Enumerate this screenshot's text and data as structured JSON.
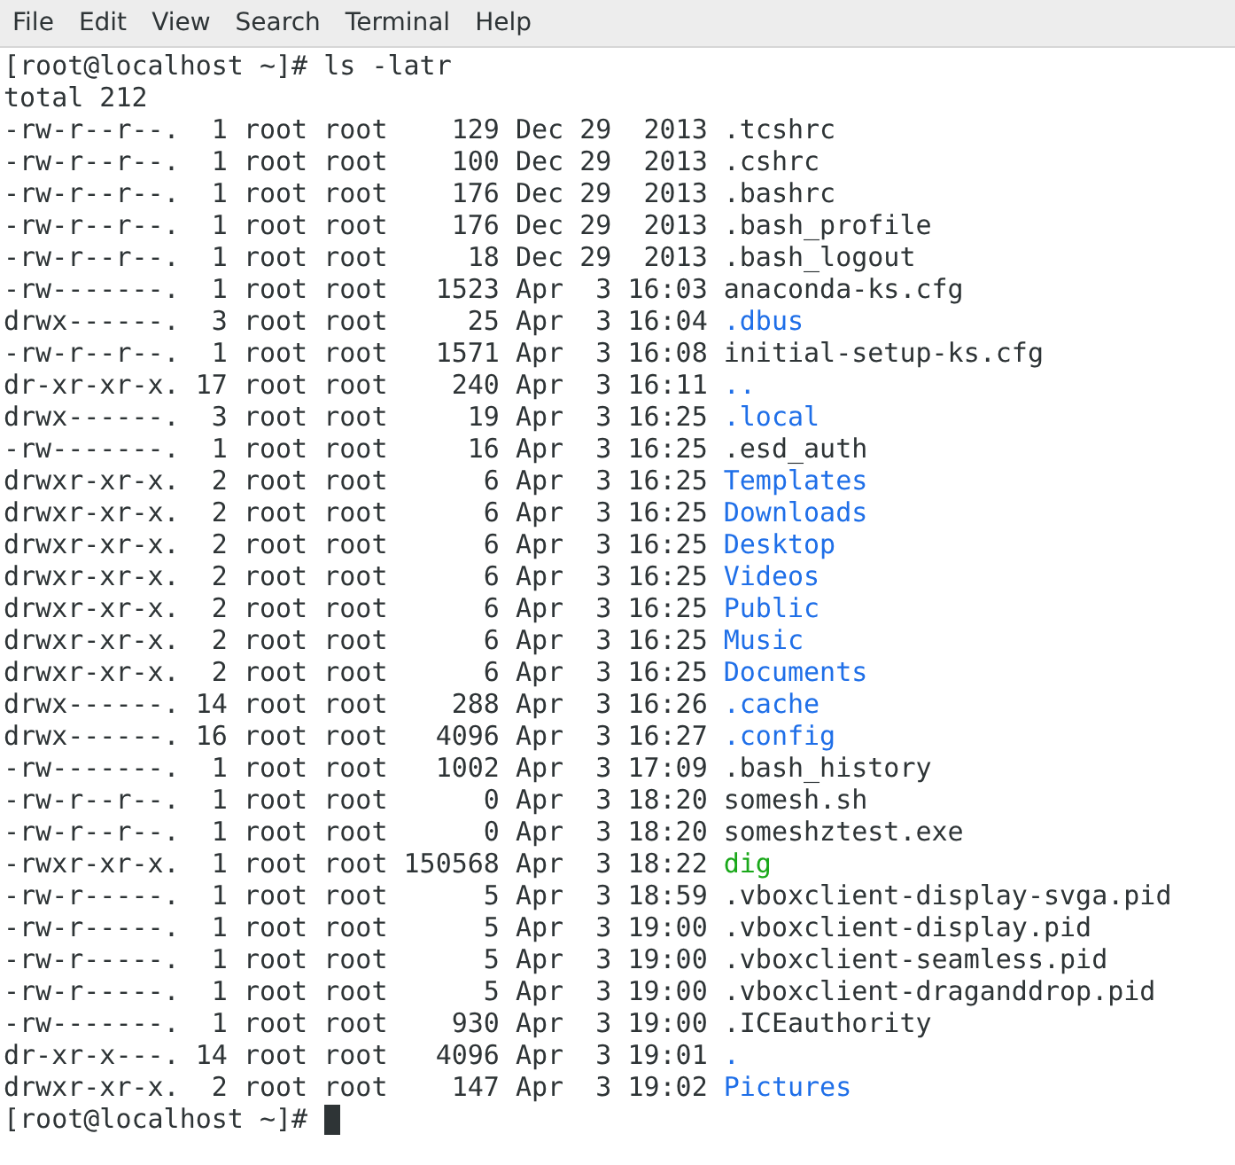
{
  "menu": [
    {
      "label": "File"
    },
    {
      "label": "Edit"
    },
    {
      "label": "View"
    },
    {
      "label": "Search"
    },
    {
      "label": "Terminal"
    },
    {
      "label": "Help"
    }
  ],
  "terminal": {
    "command": "[root@localhost ~]# ls -latr",
    "total": "total 212",
    "entries": [
      {
        "details": "-rw-r--r--.  1 root root    129 Dec 29  2013",
        "name": ".tcshrc",
        "kind": "file"
      },
      {
        "details": "-rw-r--r--.  1 root root    100 Dec 29  2013",
        "name": ".cshrc",
        "kind": "file"
      },
      {
        "details": "-rw-r--r--.  1 root root    176 Dec 29  2013",
        "name": ".bashrc",
        "kind": "file"
      },
      {
        "details": "-rw-r--r--.  1 root root    176 Dec 29  2013",
        "name": ".bash_profile",
        "kind": "file"
      },
      {
        "details": "-rw-r--r--.  1 root root     18 Dec 29  2013",
        "name": ".bash_logout",
        "kind": "file"
      },
      {
        "details": "-rw-------.  1 root root   1523 Apr  3 16:03",
        "name": "anaconda-ks.cfg",
        "kind": "file"
      },
      {
        "details": "drwx------.  3 root root     25 Apr  3 16:04",
        "name": ".dbus",
        "kind": "dir"
      },
      {
        "details": "-rw-r--r--.  1 root root   1571 Apr  3 16:08",
        "name": "initial-setup-ks.cfg",
        "kind": "file"
      },
      {
        "details": "dr-xr-xr-x. 17 root root    240 Apr  3 16:11",
        "name": "..",
        "kind": "dir"
      },
      {
        "details": "drwx------.  3 root root     19 Apr  3 16:25",
        "name": ".local",
        "kind": "dir"
      },
      {
        "details": "-rw-------.  1 root root     16 Apr  3 16:25",
        "name": ".esd_auth",
        "kind": "file"
      },
      {
        "details": "drwxr-xr-x.  2 root root      6 Apr  3 16:25",
        "name": "Templates",
        "kind": "dir"
      },
      {
        "details": "drwxr-xr-x.  2 root root      6 Apr  3 16:25",
        "name": "Downloads",
        "kind": "dir"
      },
      {
        "details": "drwxr-xr-x.  2 root root      6 Apr  3 16:25",
        "name": "Desktop",
        "kind": "dir"
      },
      {
        "details": "drwxr-xr-x.  2 root root      6 Apr  3 16:25",
        "name": "Videos",
        "kind": "dir"
      },
      {
        "details": "drwxr-xr-x.  2 root root      6 Apr  3 16:25",
        "name": "Public",
        "kind": "dir"
      },
      {
        "details": "drwxr-xr-x.  2 root root      6 Apr  3 16:25",
        "name": "Music",
        "kind": "dir"
      },
      {
        "details": "drwxr-xr-x.  2 root root      6 Apr  3 16:25",
        "name": "Documents",
        "kind": "dir"
      },
      {
        "details": "drwx------. 14 root root    288 Apr  3 16:26",
        "name": ".cache",
        "kind": "dir"
      },
      {
        "details": "drwx------. 16 root root   4096 Apr  3 16:27",
        "name": ".config",
        "kind": "dir"
      },
      {
        "details": "-rw-------.  1 root root   1002 Apr  3 17:09",
        "name": ".bash_history",
        "kind": "file"
      },
      {
        "details": "-rw-r--r--.  1 root root      0 Apr  3 18:20",
        "name": "somesh.sh",
        "kind": "file"
      },
      {
        "details": "-rw-r--r--.  1 root root      0 Apr  3 18:20",
        "name": "someshztest.exe",
        "kind": "file"
      },
      {
        "details": "-rwxr-xr-x.  1 root root 150568 Apr  3 18:22",
        "name": "dig",
        "kind": "exec"
      },
      {
        "details": "-rw-r-----.  1 root root      5 Apr  3 18:59",
        "name": ".vboxclient-display-svga.pid",
        "kind": "file"
      },
      {
        "details": "-rw-r-----.  1 root root      5 Apr  3 19:00",
        "name": ".vboxclient-display.pid",
        "kind": "file"
      },
      {
        "details": "-rw-r-----.  1 root root      5 Apr  3 19:00",
        "name": ".vboxclient-seamless.pid",
        "kind": "file"
      },
      {
        "details": "-rw-r-----.  1 root root      5 Apr  3 19:00",
        "name": ".vboxclient-draganddrop.pid",
        "kind": "file"
      },
      {
        "details": "-rw-------.  1 root root    930 Apr  3 19:00",
        "name": ".ICEauthority",
        "kind": "file"
      },
      {
        "details": "dr-xr-x---. 14 root root   4096 Apr  3 19:01",
        "name": ".",
        "kind": "dir"
      },
      {
        "details": "drwxr-xr-x.  2 root root    147 Apr  3 19:02",
        "name": "Pictures",
        "kind": "dir"
      }
    ],
    "prompt": "[root@localhost ~]#"
  }
}
